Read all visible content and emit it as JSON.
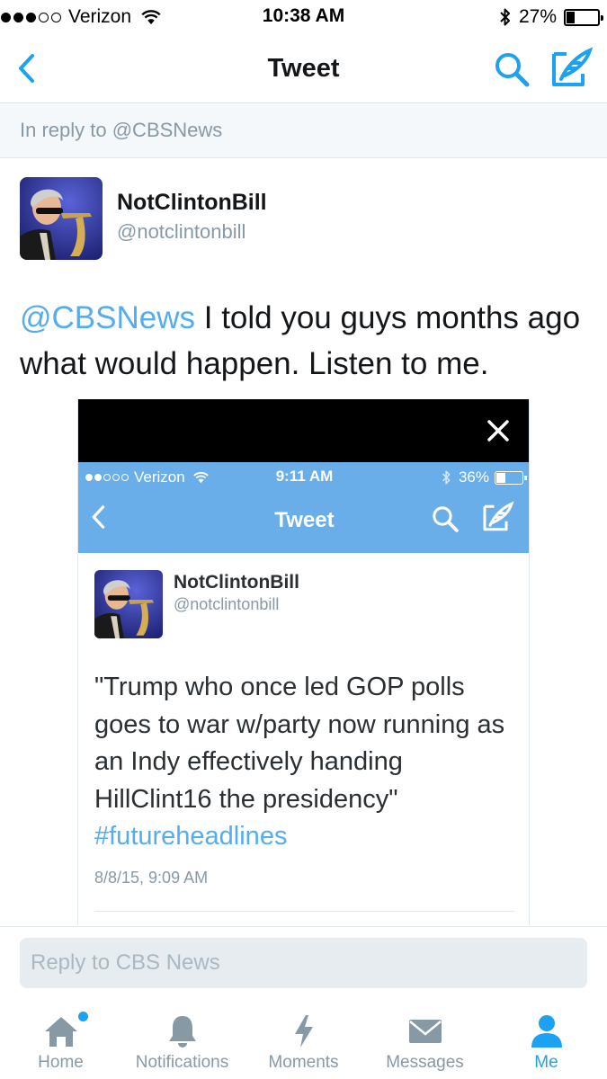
{
  "status_bar": {
    "carrier": "Verizon",
    "time": "10:38 AM",
    "battery": "27%",
    "battery_level": 0.27,
    "signal_bars_filled": 3,
    "signal_bars_total": 5
  },
  "nav": {
    "title": "Tweet",
    "back_icon": "chevron-left-icon",
    "search_icon": "search-icon",
    "compose_icon": "compose-icon"
  },
  "reply_banner": {
    "text": "In reply to @CBSNews"
  },
  "tweet": {
    "author_name": "NotClintonBill",
    "author_handle": "@notclintonbill",
    "mention": "@CBSNews",
    "body": " I told you guys months ago what would happen. Listen to me."
  },
  "media": {
    "close_icon": "close-icon",
    "inner_status_bar": {
      "carrier": "Verizon",
      "time": "9:11 AM",
      "battery": "36%",
      "battery_level": 0.36
    },
    "inner_nav_title": "Tweet",
    "inner_tweet": {
      "author_name": "NotClintonBill",
      "author_handle": "@notclintonbill",
      "text": "\"Trump who once led GOP polls goes to war w/party now running as an Indy effectively handing HillClint16 the presidency\"",
      "hashtag": "#futureheadlines",
      "timestamp": "8/8/15, 9:09 AM"
    }
  },
  "composer": {
    "placeholder": "Reply to CBS News"
  },
  "tabs": [
    {
      "label": "Home",
      "icon": "home-icon",
      "active": false,
      "has_badge": true
    },
    {
      "label": "Notifications",
      "icon": "bell-icon",
      "active": false
    },
    {
      "label": "Moments",
      "icon": "lightning-icon",
      "active": false
    },
    {
      "label": "Messages",
      "icon": "envelope-icon",
      "active": false
    },
    {
      "label": "Me",
      "icon": "person-icon",
      "active": true
    }
  ],
  "colors": {
    "accent": "#1da1f2",
    "mention": "#55acee",
    "inner_header": "#6aaee9",
    "muted": "#8899a6"
  }
}
